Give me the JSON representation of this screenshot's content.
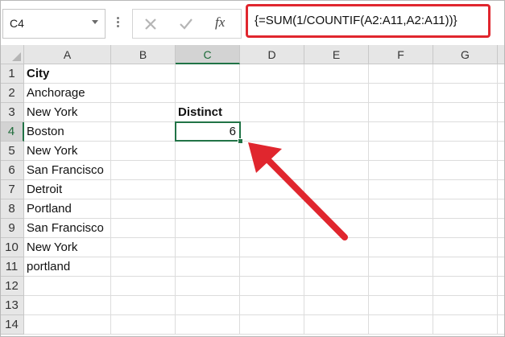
{
  "name_box": {
    "value": "C4"
  },
  "formula_bar": {
    "cancel_icon": "close-icon",
    "enter_icon": "check-icon",
    "fx_label": "fx",
    "formula": "{=SUM(1/COUNTIF(A2:A11,A2:A11))}"
  },
  "columns": [
    "A",
    "B",
    "C",
    "D",
    "E",
    "F",
    "G"
  ],
  "selected_column": "C",
  "rows": [
    "1",
    "2",
    "3",
    "4",
    "5",
    "6",
    "7",
    "8",
    "9",
    "10",
    "11",
    "12",
    "13",
    "14"
  ],
  "selected_row": "4",
  "cells": {
    "A1": "City",
    "A2": "Anchorage",
    "A3": "New York",
    "A4": "Boston",
    "A5": "New York",
    "A6": "San Francisco",
    "A7": "Detroit",
    "A8": "Portland",
    "A9": "San Francisco",
    "A10": "New York",
    "A11": "portland",
    "C3": "Distinct",
    "C4": "6"
  },
  "colors": {
    "highlight_border": "#e0262e",
    "annotation_arrow": "#e0262e",
    "selection_green": "#217346"
  }
}
